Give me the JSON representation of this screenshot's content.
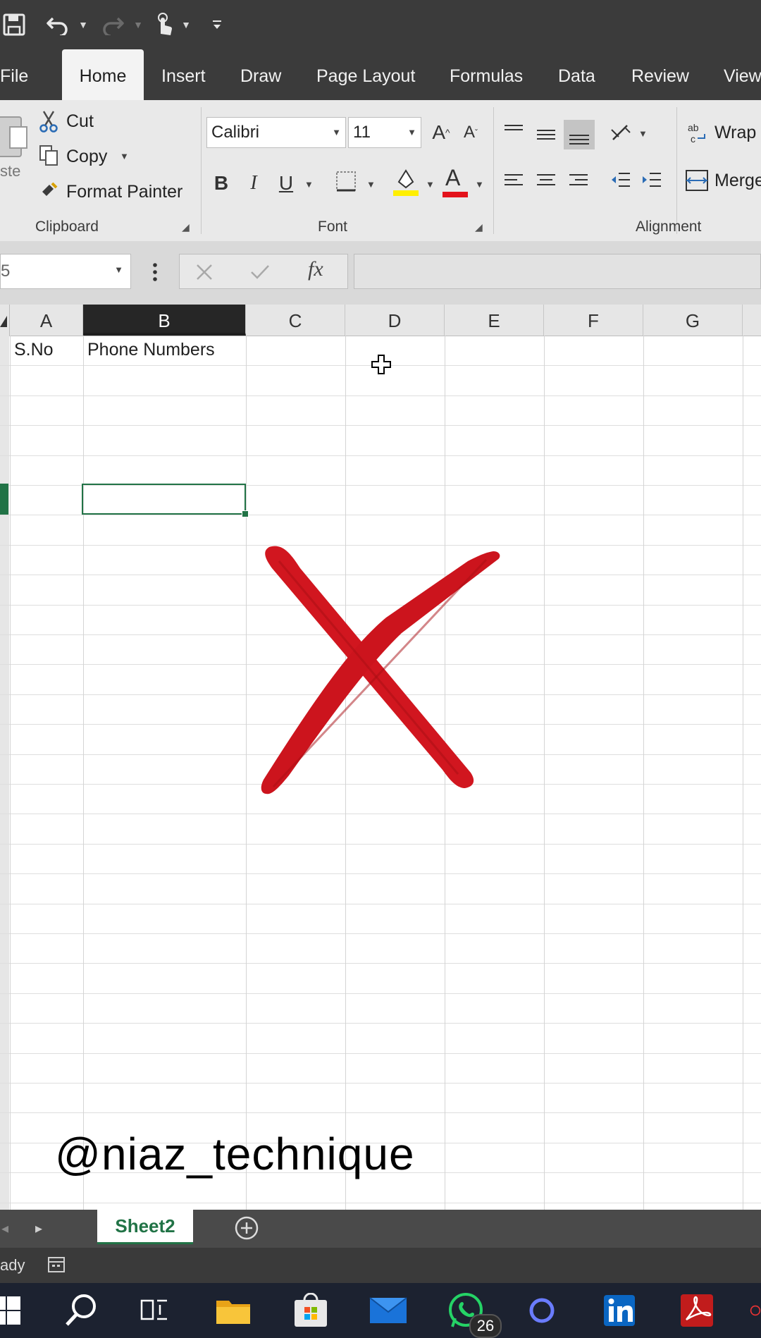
{
  "ribbon_tabs": [
    "File",
    "Home",
    "Insert",
    "Draw",
    "Page Layout",
    "Formulas",
    "Data",
    "Review",
    "View"
  ],
  "active_tab": "Home",
  "clipboard": {
    "paste_label": "ste",
    "cut_label": "Cut",
    "copy_label": "Copy",
    "format_painter_label": "Format Painter",
    "group_label": "Clipboard"
  },
  "font": {
    "font_name": "Calibri",
    "font_size": "11",
    "group_label": "Font",
    "bold": "B",
    "italic": "I",
    "underline": "U",
    "grow": "A",
    "shrink": "A",
    "font_color": "A"
  },
  "alignment": {
    "wrap_label": "Wrap",
    "merge_label": "Merge",
    "group_label": "Alignment"
  },
  "formula_bar": {
    "name_box": "5",
    "fx_label": "fx",
    "value": ""
  },
  "columns": [
    "A",
    "B",
    "C",
    "D",
    "E",
    "F",
    "G"
  ],
  "selected_column": "B",
  "cells": {
    "A1": "S.No",
    "B1": "Phone Numbers"
  },
  "selected_cell_row": 5,
  "sheet_tabs": [
    "Sheet2"
  ],
  "status_text": "ady",
  "taskbar": {
    "whatsapp_badge": "26"
  },
  "watermark": "@niaz_technique",
  "colors": {
    "ribbon_dark": "#3b3b3b",
    "ribbon_light": "#e9e9e9",
    "accent_green": "#217346",
    "cross_red": "#d1161f"
  },
  "icons": [
    "save-icon",
    "undo-icon",
    "redo-icon",
    "touch-mode-icon",
    "customize-qat-icon",
    "cut-icon",
    "copy-icon",
    "format-painter-icon",
    "paste-icon",
    "windows-start-icon",
    "search-icon",
    "task-view-icon",
    "file-explorer-icon",
    "store-icon",
    "mail-icon",
    "whatsapp-icon",
    "cortana-icon",
    "linkedin-icon",
    "acrobat-icon"
  ]
}
